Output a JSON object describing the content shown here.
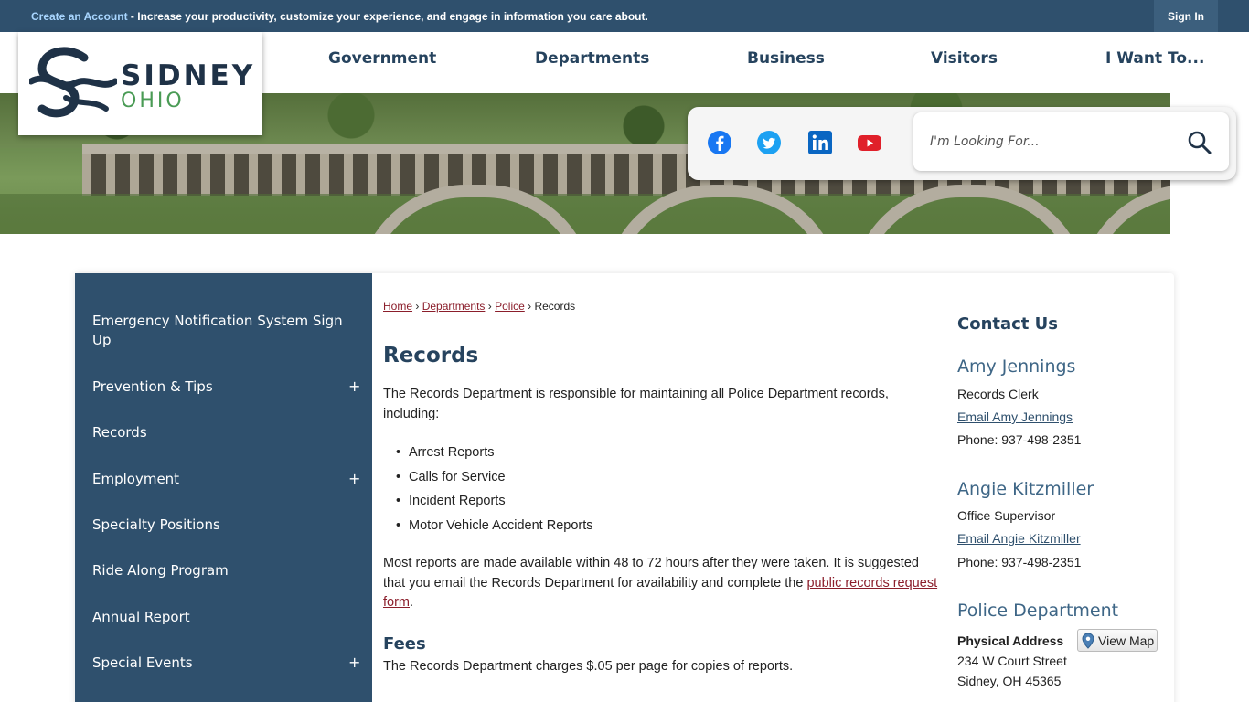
{
  "topbar": {
    "create_account": "Create an Account",
    "message": " - Increase your productivity, customize your experience, and engage in information you care about.",
    "sign_in": "Sign In"
  },
  "logo": {
    "line1": "SIDNEY",
    "line2": "OHIO"
  },
  "nav": {
    "items": [
      "Government",
      "Departments",
      "Business",
      "Visitors",
      "I Want To..."
    ]
  },
  "social": {
    "icons": [
      "facebook-icon",
      "twitter-icon",
      "linkedin-icon",
      "youtube-icon"
    ]
  },
  "search": {
    "placeholder": "I'm Looking For..."
  },
  "sidebar": {
    "items": [
      {
        "label": "Emergency Notification System Sign Up",
        "expandable": false
      },
      {
        "label": "Prevention & Tips",
        "expandable": true
      },
      {
        "label": "Records",
        "expandable": false
      },
      {
        "label": "Employment",
        "expandable": true
      },
      {
        "label": "Specialty Positions",
        "expandable": false
      },
      {
        "label": "Ride Along Program",
        "expandable": false
      },
      {
        "label": "Annual Report",
        "expandable": false
      },
      {
        "label": "Special Events",
        "expandable": true
      }
    ],
    "expand_symbol": "+"
  },
  "breadcrumb": {
    "home": "Home",
    "departments": "Departments",
    "police": "Police",
    "current": "Records",
    "sep": "›"
  },
  "main": {
    "title": "Records",
    "intro": "The Records Department is responsible for maintaining all Police Department records, including:",
    "bullets": [
      "Arrest Reports",
      "Calls for Service",
      "Incident Reports",
      "Motor Vehicle Accident Reports"
    ],
    "availability_text": "Most reports are made available within 48 to 72 hours after they were taken. It is suggested that you email the Records Department for availability and complete the ",
    "availability_link": "public records request form",
    "availability_end": ".",
    "fees_heading": "Fees",
    "fees_text": "The Records Department charges $.05 per page for copies of reports."
  },
  "contact": {
    "heading": "Contact Us",
    "people": [
      {
        "name": "Amy Jennings",
        "role": "Records Clerk",
        "email": "Email Amy Jennings",
        "phone": "Phone: 937-498-2351"
      },
      {
        "name": "Angie Kitzmiller",
        "role": "Office Supervisor",
        "email": "Email Angie Kitzmiller",
        "phone": "Phone: 937-498-2351"
      }
    ],
    "department": {
      "name": "Police Department",
      "address_label": "Physical Address",
      "view_map": "View Map",
      "street": "234 W Court Street",
      "city": "Sidney, OH 45365"
    }
  }
}
